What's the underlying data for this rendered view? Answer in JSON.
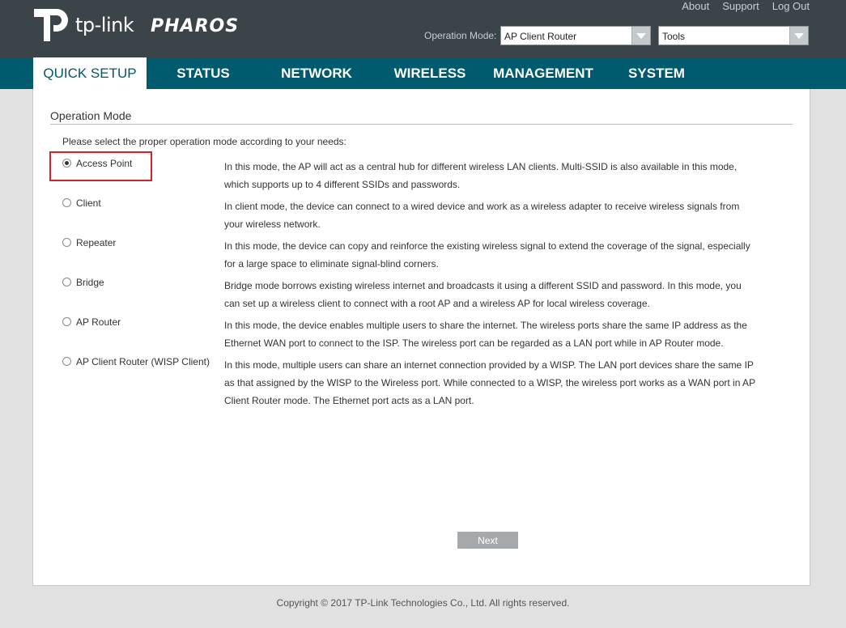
{
  "header": {
    "brand": "tp-link",
    "product": "PHAROS",
    "links": [
      "About",
      "Support",
      "Log Out"
    ],
    "operation_mode_label": "Operation Mode:",
    "operation_mode_value": "AP Client Router",
    "tools_value": "Tools",
    "icons": [
      "tp-link-logo-icon",
      "chevron-down-icon"
    ]
  },
  "nav": {
    "tabs": [
      "QUICK SETUP",
      "STATUS",
      "NETWORK",
      "WIRELESS",
      "MANAGEMENT",
      "SYSTEM"
    ],
    "active": "QUICK SETUP"
  },
  "main": {
    "section_title": "Operation Mode",
    "intro": "Please select the proper operation mode according to your needs:",
    "modes": [
      {
        "label": "Access Point",
        "checked": true,
        "desc": "In this mode, the AP will act as a central hub for different wireless LAN clients. Multi-SSID is also available in this mode, which supports up to 4 different SSIDs and passwords."
      },
      {
        "label": "Client",
        "checked": false,
        "desc": "In client mode, the device can connect to a wired device and work as a wireless adapter to receive wireless signals from your wireless network."
      },
      {
        "label": "Repeater",
        "checked": false,
        "desc": "In this mode, the device can copy and reinforce the existing wireless signal to extend the coverage of the signal, especially for a large space to eliminate signal-blind corners."
      },
      {
        "label": "Bridge",
        "checked": false,
        "desc": "Bridge mode borrows existing wireless internet and broadcasts it using a different SSID and password. In this mode, you can set up a wireless client to connect with a root AP and a wireless AP for local wireless coverage."
      },
      {
        "label": "AP Router",
        "checked": false,
        "desc": "In this mode, the device enables multiple users to share the internet. The wireless ports share the same IP address as the Ethernet WAN port to connect to the ISP. The wireless port can be regarded as a LAN port while in AP Router mode."
      },
      {
        "label": "AP Client Router (WISP Client)",
        "checked": false,
        "desc": "In this mode, multiple users can share an internet connection provided by a WISP. The LAN port devices share the same IP as that assigned by the WISP to the Wireless port. While connected to a WISP, the wireless port works as a WAN port in AP Client Router mode. The Ethernet port acts as a LAN port."
      }
    ],
    "next_label": "Next"
  },
  "footer": {
    "copyright": "Copyright © 2017 TP-Link Technologies Co., Ltd. All rights reserved."
  },
  "colors": {
    "header_bg": "#3b4449",
    "nav_bg": "#005a6d",
    "highlight": "#d0242d",
    "button": "#a6a9ab"
  }
}
